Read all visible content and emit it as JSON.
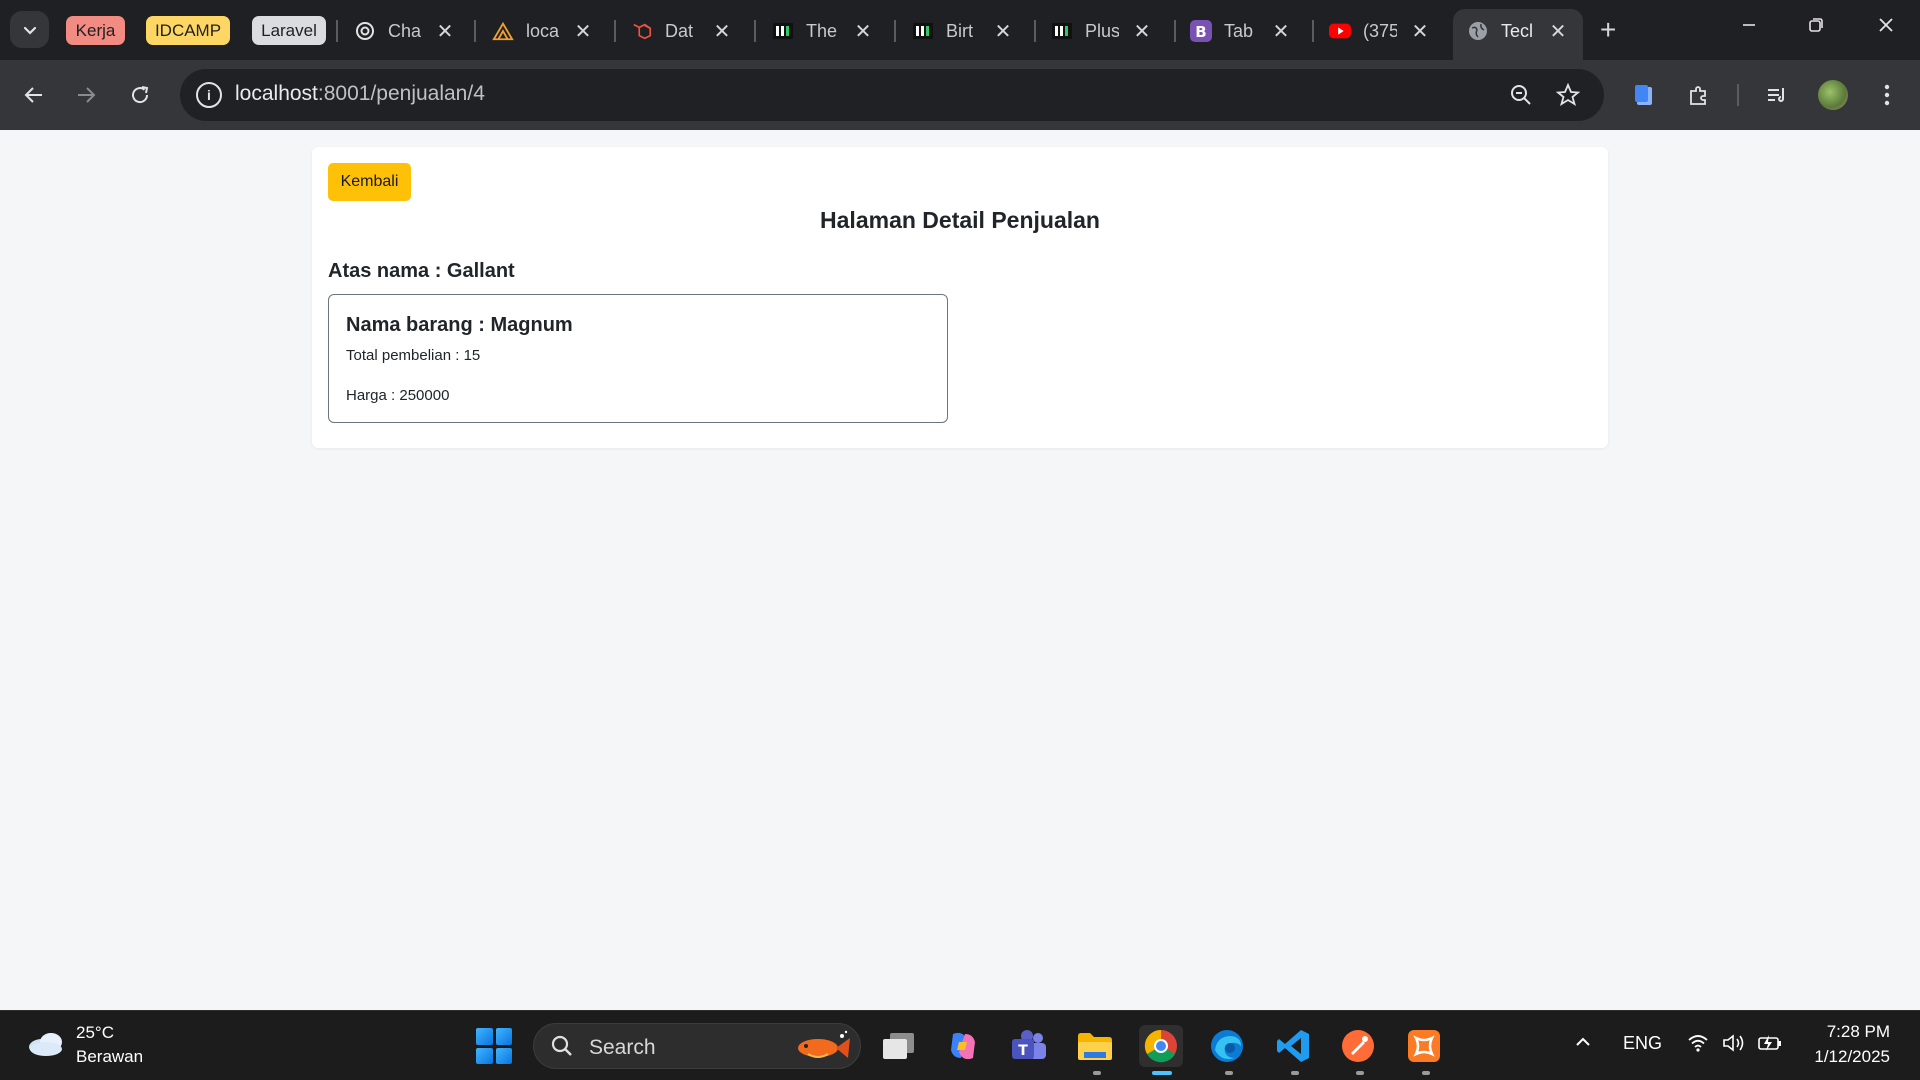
{
  "browser": {
    "tab_groups": [
      {
        "label": "Kerja",
        "color": "#f28b82"
      },
      {
        "label": "IDCAMP",
        "color": "#fdd663"
      },
      {
        "label": "Laravel",
        "color": "#dadce0"
      }
    ],
    "tabs": [
      {
        "title": "Cha",
        "icon": "openai-icon"
      },
      {
        "title": "loca",
        "icon": "xampp-icon"
      },
      {
        "title": "Dat",
        "icon": "laravel-icon"
      },
      {
        "title": "The",
        "icon": "hackerrank-icon"
      },
      {
        "title": "Birt",
        "icon": "hackerrank-icon"
      },
      {
        "title": "Plus",
        "icon": "hackerrank-icon"
      },
      {
        "title": "Tab",
        "icon": "bootstrap-icon"
      },
      {
        "title": "(375",
        "icon": "youtube-icon"
      }
    ],
    "active_tab": {
      "title": "Tecl",
      "icon": "globe-icon"
    },
    "url_host": "localhost",
    "url_path": ":8001/penjualan/4"
  },
  "page": {
    "back_button": "Kembali",
    "title": "Halaman Detail Penjualan",
    "buyer_label": "Atas nama : Gallant",
    "item": {
      "name_label": "Nama barang : Magnum",
      "total_label": "Total pembelian : 15",
      "price_label": "Harga : 250000"
    }
  },
  "taskbar": {
    "weather_temp": "25°C",
    "weather_desc": "Berawan",
    "search_placeholder": "Search",
    "language": "ENG",
    "time": "7:28 PM",
    "date": "1/12/2025"
  },
  "colors": {
    "accent_button": "#ffc107",
    "browser_frame": "#1f2023",
    "toolbar": "#35363a",
    "page_bg": "#f5f6f8"
  }
}
